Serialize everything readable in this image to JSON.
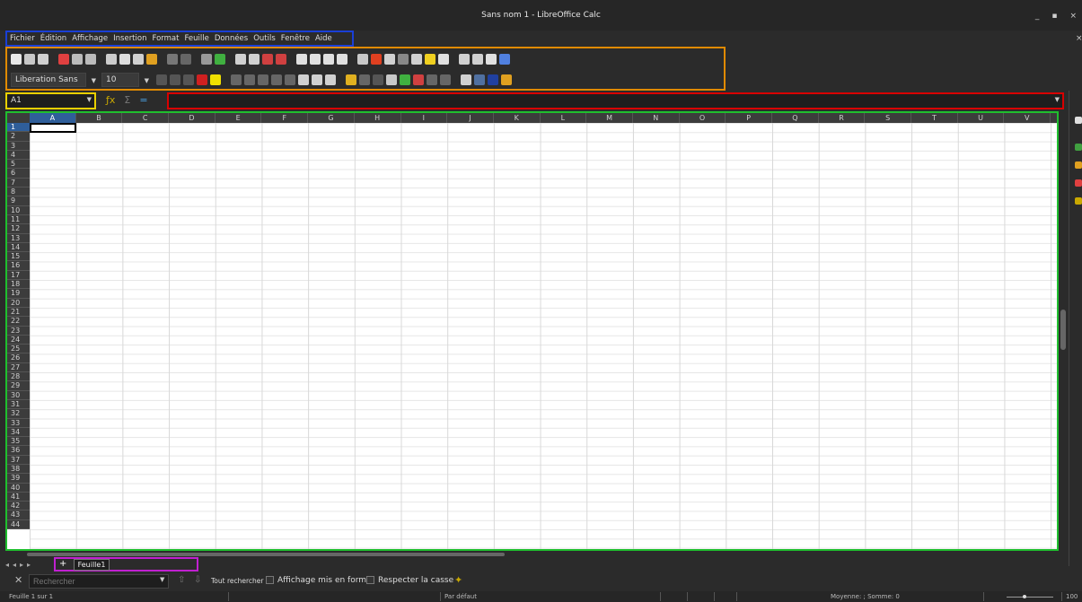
{
  "window": {
    "title": "Sans nom 1 - LibreOffice Calc",
    "min": "_",
    "max": "▪",
    "close": "×"
  },
  "menu": [
    "Fichier",
    "Édition",
    "Affichage",
    "Insertion",
    "Format",
    "Feuille",
    "Données",
    "Outils",
    "Fenêtre",
    "Aide"
  ],
  "menu_close": "×",
  "toolbar": {
    "font_name": "Liberation Sans",
    "font_size": "10"
  },
  "formula_bar": {
    "cell_ref": "A1",
    "content": ""
  },
  "columns": [
    "A",
    "B",
    "C",
    "D",
    "E",
    "F",
    "G",
    "H",
    "I",
    "J",
    "K",
    "L",
    "M",
    "N",
    "O",
    "P",
    "Q",
    "R",
    "S",
    "T",
    "U",
    "V"
  ],
  "rows": [
    "1",
    "2",
    "3",
    "4",
    "5",
    "6",
    "7",
    "8",
    "9",
    "10",
    "11",
    "12",
    "13",
    "14",
    "15",
    "16",
    "17",
    "18",
    "19",
    "20",
    "21",
    "22",
    "23",
    "24",
    "25",
    "26",
    "27",
    "28",
    "29",
    "30",
    "31",
    "32",
    "33",
    "34",
    "35",
    "36",
    "37",
    "38",
    "39",
    "40",
    "41",
    "42",
    "43",
    "44"
  ],
  "sheets": {
    "add": "+",
    "tabs": [
      "Feuille1"
    ]
  },
  "find": {
    "placeholder": "Rechercher",
    "find_all": "Tout rechercher",
    "formatted_display": "Affichage mis en forme",
    "match_case": "Respecter la casse"
  },
  "status": {
    "sheet": "Feuille 1 sur 1",
    "style": "Par défaut",
    "sum": "Moyenne: ; Somme: 0",
    "zoom": "100"
  },
  "colors": {
    "menu_border": "#1a3fd6",
    "toolbar_border": "#e08a00",
    "namebox_border": "#e8d000",
    "formula_border": "#d80000",
    "grid_border": "#1fbf2e",
    "tab_border": "#c020d0"
  }
}
